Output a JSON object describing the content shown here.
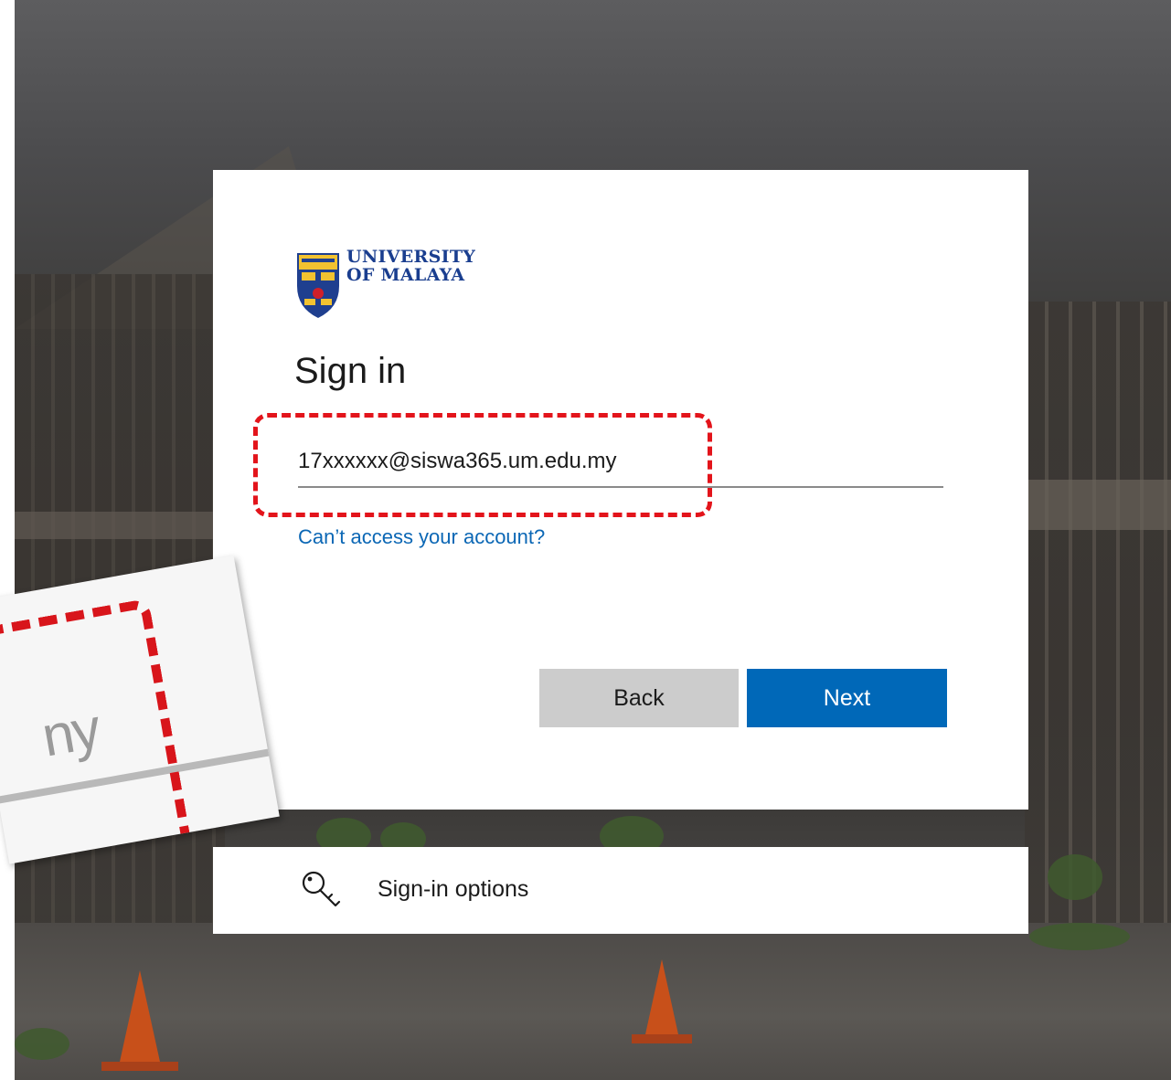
{
  "brand": {
    "logo_line1": "UNIVERSITY",
    "logo_line2": "OF MALAYA",
    "primary_color": "#0068b8",
    "highlight_color": "#e3141b"
  },
  "signin": {
    "title": "Sign in",
    "email_value": "17xxxxxx@siswa365.um.edu.my",
    "cant_access_link": "Can’t access your account?",
    "back_label": "Back",
    "next_label": "Next"
  },
  "options": {
    "label": "Sign-in options",
    "icon": "key-icon"
  },
  "zoom_callout": {
    "text": "ny"
  }
}
